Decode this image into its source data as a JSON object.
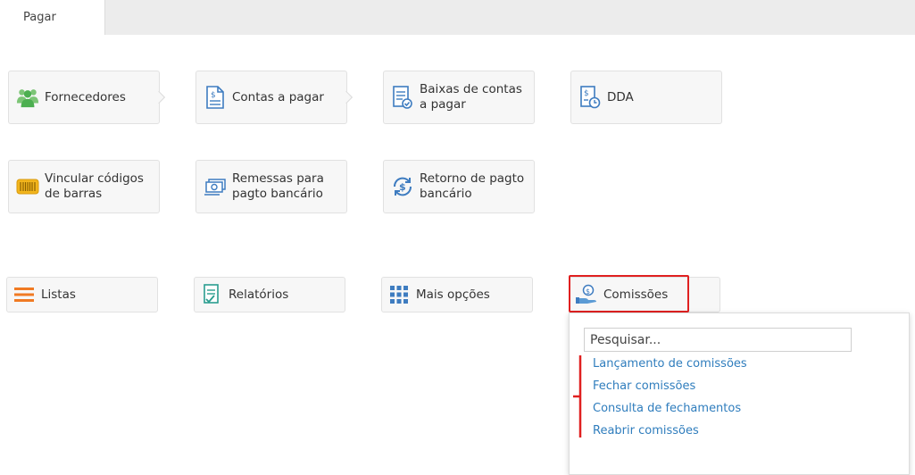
{
  "tabs": [
    {
      "label": "Pagar"
    }
  ],
  "cards": [
    {
      "label": "Fornecedores",
      "icon": "people-icon"
    },
    {
      "label": "Contas a pagar",
      "icon": "bill-icon"
    },
    {
      "label": "Baixas de contas a pagar",
      "icon": "checklist-icon"
    },
    {
      "label": "DDA",
      "icon": "clock-document-icon"
    },
    {
      "label": "Vincular códigos de barras",
      "icon": "barcode-icon"
    },
    {
      "label": "Remessas para pagto bancário",
      "icon": "money-icon"
    },
    {
      "label": "Retorno de pagto bancário",
      "icon": "refresh-dollar-icon"
    }
  ],
  "bottom_bar": [
    {
      "label": "Listas",
      "icon": "list-icon"
    },
    {
      "label": "Relatórios",
      "icon": "report-icon"
    },
    {
      "label": "Mais opções",
      "icon": "grid-icon"
    },
    {
      "label": "Comissões",
      "icon": "hand-dollar-icon"
    }
  ],
  "dropdown": {
    "search_placeholder": "Pesquisar...",
    "items": [
      {
        "label": "Lançamento de comissões"
      },
      {
        "label": "Fechar comissões"
      },
      {
        "label": "Consulta de fechamentos"
      },
      {
        "label": "Reabrir comissões"
      }
    ]
  },
  "colors": {
    "link": "#2f7dbd",
    "highlight": "#e02020",
    "icon_blue": "#3e7cc0",
    "icon_green": "#5cb85c",
    "icon_orange": "#f07a23",
    "icon_yellow": "#f2b51d",
    "icon_teal": "#2a9d8f"
  }
}
